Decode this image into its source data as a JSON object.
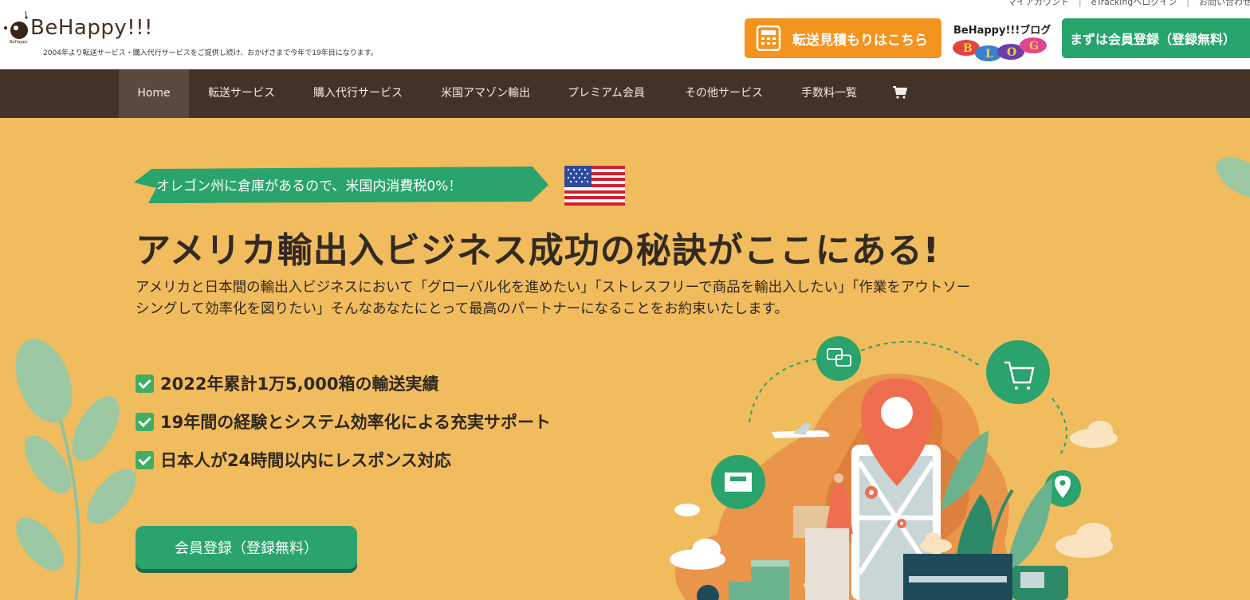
{
  "header": {
    "logo_text": "BeHappy!!!",
    "tagline": "2004年より転送サービス・購入代行サービスをご提供し続け、おかげさまで今年で19年目になります。",
    "top_links": [
      "マイアカウント",
      "eTrackingへログイン",
      "お問い合わせ"
    ],
    "estimate_button": "転送見積もりはこちら",
    "blog_title": "BeHappy!!!ブログ",
    "blog_letters": [
      "B",
      "L",
      "O",
      "G"
    ],
    "register_button": "まずは会員登録（登録無料）"
  },
  "nav": {
    "items": [
      {
        "label": "Home",
        "active": true
      },
      {
        "label": "転送サービス"
      },
      {
        "label": "購入代行サービス"
      },
      {
        "label": "米国アマゾン輸出"
      },
      {
        "label": "プレミアム会員"
      },
      {
        "label": "その他サービス"
      },
      {
        "label": "手数料一覧"
      }
    ],
    "cart_icon": "cart-icon"
  },
  "hero": {
    "ribbon": "オレゴン州に倉庫があるので、米国内消費税0%！",
    "headline": "アメリカ輸出入ビジネス成功の秘訣がここにある!",
    "description": "アメリカと日本間の輸出入ビジネスにおいて「グローバル化を進めたい」「ストレスフリーで商品を輸出入したい」「作業をアウトソーシングして効率化を図りたい」そんなあなたにとって最高のパートナーになることをお約束いたします。",
    "checks": [
      "2022年累計1万5,000箱の輸送実績",
      "19年間の経験とシステム効率化による充実サポート",
      "日本人が24時間以内にレスポンス対応"
    ],
    "cta": "会員登録（登録無料）"
  },
  "colors": {
    "hero_bg": "#f1bc5e",
    "nav_bg": "#433226",
    "estimate_orange": "#f5931f",
    "green": "#27a36c"
  }
}
